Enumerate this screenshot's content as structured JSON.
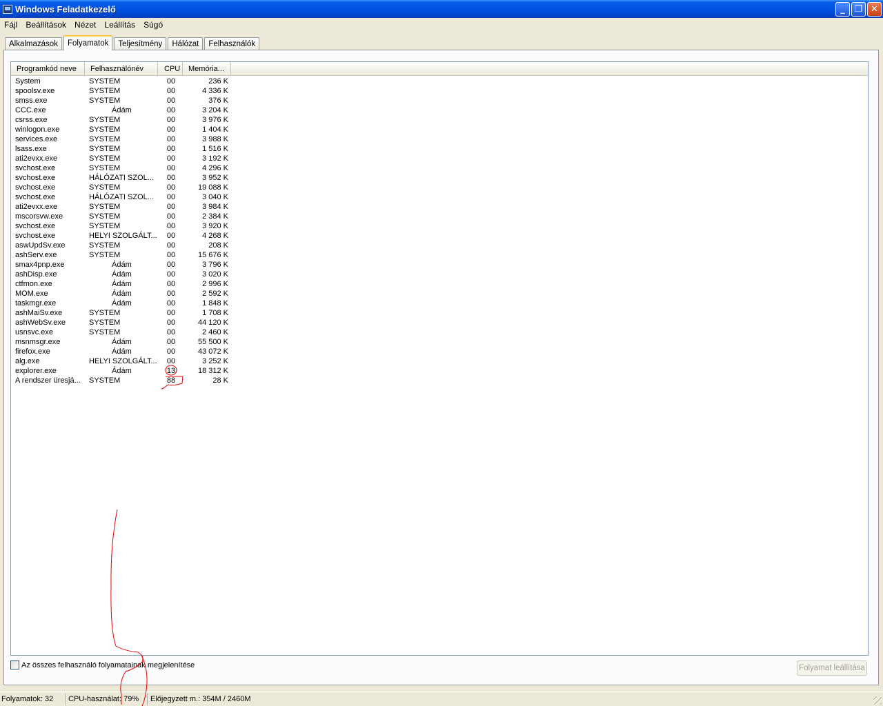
{
  "window": {
    "title": "Windows Feladatkezelő",
    "minimize_symbol": "_",
    "maximize_symbol": "❐",
    "close_symbol": "✕",
    "title_icon": "task-manager-icon"
  },
  "menu": [
    "Fájl",
    "Beállítások",
    "Nézet",
    "Leállítás",
    "Súgó"
  ],
  "tabs": [
    {
      "label": "Alkalmazások",
      "active": false
    },
    {
      "label": "Folyamatok",
      "active": true
    },
    {
      "label": "Teljesítmény",
      "active": false
    },
    {
      "label": "Hálózat",
      "active": false
    },
    {
      "label": "Felhasználók",
      "active": false
    }
  ],
  "process_list": {
    "columns": [
      "Programkód neve",
      "Felhasználónév",
      "CPU",
      "Memória..."
    ],
    "rows": [
      {
        "name": "System",
        "user": "SYSTEM",
        "cpu": "00",
        "mem": "236 K"
      },
      {
        "name": "spoolsv.exe",
        "user": "SYSTEM",
        "cpu": "00",
        "mem": "4 336 K"
      },
      {
        "name": "smss.exe",
        "user": "SYSTEM",
        "cpu": "00",
        "mem": "376 K"
      },
      {
        "name": "CCC.exe",
        "user": "Ádám",
        "cpu": "00",
        "mem": "3 204 K"
      },
      {
        "name": "csrss.exe",
        "user": "SYSTEM",
        "cpu": "00",
        "mem": "3 976 K"
      },
      {
        "name": "winlogon.exe",
        "user": "SYSTEM",
        "cpu": "00",
        "mem": "1 404 K"
      },
      {
        "name": "services.exe",
        "user": "SYSTEM",
        "cpu": "00",
        "mem": "3 988 K"
      },
      {
        "name": "lsass.exe",
        "user": "SYSTEM",
        "cpu": "00",
        "mem": "1 516 K"
      },
      {
        "name": "ati2evxx.exe",
        "user": "SYSTEM",
        "cpu": "00",
        "mem": "3 192 K"
      },
      {
        "name": "svchost.exe",
        "user": "SYSTEM",
        "cpu": "00",
        "mem": "4 296 K"
      },
      {
        "name": "svchost.exe",
        "user": "HÁLÓZATI SZOL...",
        "cpu": "00",
        "mem": "3 952 K"
      },
      {
        "name": "svchost.exe",
        "user": "SYSTEM",
        "cpu": "00",
        "mem": "19 088 K"
      },
      {
        "name": "svchost.exe",
        "user": "HÁLÓZATI SZOL...",
        "cpu": "00",
        "mem": "3 040 K"
      },
      {
        "name": "ati2evxx.exe",
        "user": "SYSTEM",
        "cpu": "00",
        "mem": "3 984 K"
      },
      {
        "name": "mscorsvw.exe",
        "user": "SYSTEM",
        "cpu": "00",
        "mem": "2 384 K"
      },
      {
        "name": "svchost.exe",
        "user": "SYSTEM",
        "cpu": "00",
        "mem": "3 920 K"
      },
      {
        "name": "svchost.exe",
        "user": "HELYI SZOLGÁLT...",
        "cpu": "00",
        "mem": "4 268 K"
      },
      {
        "name": "aswUpdSv.exe",
        "user": "SYSTEM",
        "cpu": "00",
        "mem": "208 K"
      },
      {
        "name": "ashServ.exe",
        "user": "SYSTEM",
        "cpu": "00",
        "mem": "15 676 K"
      },
      {
        "name": "smax4pnp.exe",
        "user": "Ádám",
        "cpu": "00",
        "mem": "3 796 K"
      },
      {
        "name": "ashDisp.exe",
        "user": "Ádám",
        "cpu": "00",
        "mem": "3 020 K"
      },
      {
        "name": "ctfmon.exe",
        "user": "Ádám",
        "cpu": "00",
        "mem": "2 996 K"
      },
      {
        "name": "MOM.exe",
        "user": "Ádám",
        "cpu": "00",
        "mem": "2 592 K"
      },
      {
        "name": "taskmgr.exe",
        "user": "Ádám",
        "cpu": "00",
        "mem": "1 848 K"
      },
      {
        "name": "ashMaiSv.exe",
        "user": "SYSTEM",
        "cpu": "00",
        "mem": "1 708 K"
      },
      {
        "name": "ashWebSv.exe",
        "user": "SYSTEM",
        "cpu": "00",
        "mem": "44 120 K"
      },
      {
        "name": "usnsvc.exe",
        "user": "SYSTEM",
        "cpu": "00",
        "mem": "2 460 K"
      },
      {
        "name": "msnmsgr.exe",
        "user": "Ádám",
        "cpu": "00",
        "mem": "55 500 K"
      },
      {
        "name": "firefox.exe",
        "user": "Ádám",
        "cpu": "00",
        "mem": "43 072 K"
      },
      {
        "name": "alg.exe",
        "user": "HELYI SZOLGÁLT...",
        "cpu": "00",
        "mem": "3 252 K"
      },
      {
        "name": "explorer.exe",
        "user": "Ádám",
        "cpu": "13",
        "mem": "18 312 K"
      },
      {
        "name": "A rendszer üresjá...",
        "user": "SYSTEM",
        "cpu": "88",
        "mem": "28 K"
      }
    ]
  },
  "show_all_users": {
    "label": "Az összes felhasználó folyamatainak megjelenítése",
    "checked": false
  },
  "end_process_button": {
    "label": "Folyamat leállítása",
    "enabled": false
  },
  "statusbar": {
    "processes": "Folyamatok: 32",
    "cpu_usage": "CPU-használat: 79%",
    "commit_charge": "Előjegyzett m.: 354M / 2460M"
  },
  "colors": {
    "titlebar": "#0054e3",
    "annotation": "#e00000",
    "window_bg": "#ece9d8"
  }
}
